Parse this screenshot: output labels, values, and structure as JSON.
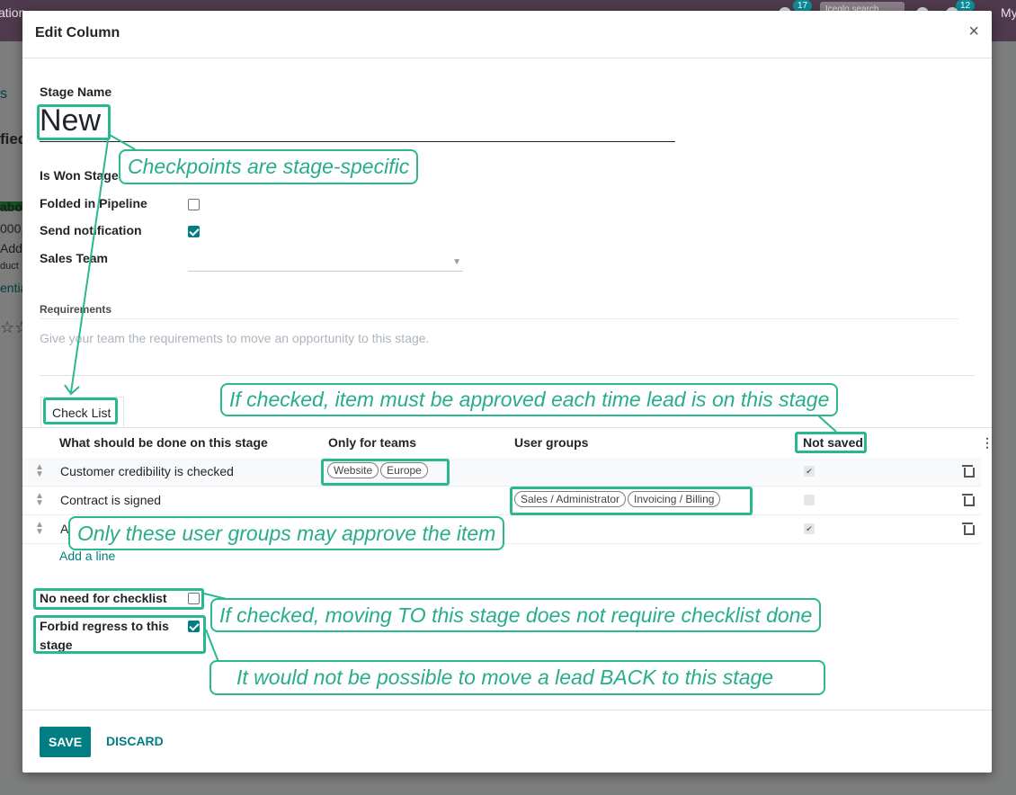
{
  "background": {
    "app_name": "ation",
    "bdg1": "17",
    "bdg2": "12",
    "search": "Iceglo search",
    "user": "My",
    "frags": [
      "s",
      "fied",
      "abou",
      "000.",
      "Add",
      "duct",
      "entia",
      "☆☆"
    ]
  },
  "dialog": {
    "title": "Edit Column",
    "close": "×"
  },
  "form": {
    "stage_name_label": "Stage Name",
    "stage_name_value": "New",
    "is_won_label": "Is Won Stage?",
    "folded_label": "Folded in Pipeline",
    "folded_checked": false,
    "send_notification_label": "Send notification",
    "send_notification_checked": true,
    "sales_team_label": "Sales Team",
    "sales_team_value": "",
    "requirements_label": "Requirements",
    "requirements_placeholder": "Give your team the requirements to move an opportunity to this stage."
  },
  "tabs": [
    {
      "label": "Check List",
      "active": true
    }
  ],
  "checklist": {
    "columns": [
      "What should be done on this stage",
      "Only for teams",
      "User groups",
      "Not saved"
    ],
    "rows": [
      {
        "task": "Customer credibility is checked",
        "teams": [
          "Website",
          "Europe"
        ],
        "groups": [],
        "not_saved": true
      },
      {
        "task": "Contract is signed",
        "teams": [],
        "groups": [
          "Sales / Administrator",
          "Invoicing / Billing"
        ],
        "not_saved": false
      },
      {
        "task": "A",
        "teams": [],
        "groups": [],
        "not_saved": true
      }
    ],
    "add_line": "Add a line"
  },
  "options": {
    "no_need_label": "No need for checklist",
    "no_need_checked": false,
    "forbid_regress_label": "Forbid regress to this stage",
    "forbid_regress_checked": true
  },
  "footer": {
    "save": "SAVE",
    "discard": "DISCARD"
  },
  "annotations": {
    "checkpoints": "Checkpoints are stage-specific",
    "if_checked": "If checked, item must be approved each time lead is on this stage",
    "user_groups": "Only these user groups may approve the item",
    "no_checklist": "If checked, moving TO this stage does not require checklist done",
    "regress": "It would not be possible to move a lead BACK to this stage",
    "accent_color": "#2bb78f"
  }
}
